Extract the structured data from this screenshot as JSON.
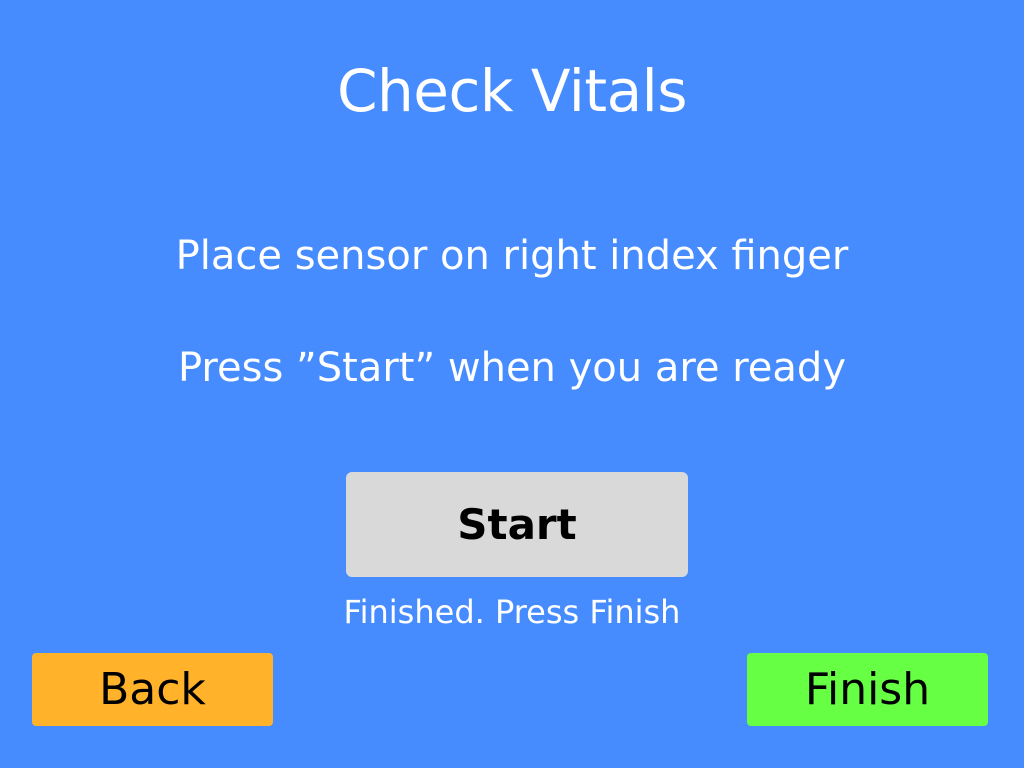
{
  "screen": {
    "title": "Check Vitals",
    "instruction_line1": "Place sensor on right index finger",
    "instruction_line2": "Press  ”Start” when you are ready",
    "status_text": "Finished. Press Finish"
  },
  "buttons": {
    "start_label": "Start",
    "back_label": "Back",
    "finish_label": "Finish"
  },
  "colors": {
    "background": "#468cff",
    "start_button": "#d9d9d9",
    "back_button": "#ffb22a",
    "finish_button": "#66ff44",
    "text_light": "#ffffff"
  }
}
